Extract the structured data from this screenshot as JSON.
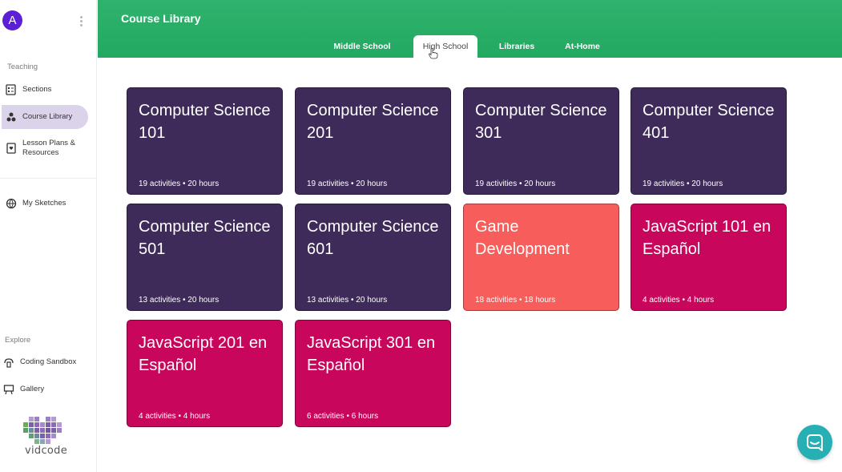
{
  "user": {
    "avatar_initial": "A"
  },
  "sidebar": {
    "teaching_label": "Teaching",
    "explore_label": "Explore",
    "items": {
      "sections": "Sections",
      "course_library": "Course Library",
      "lesson_plans_line1": "Lesson Plans &",
      "lesson_plans_line2": "Resources",
      "my_sketches": "My Sketches",
      "coding_sandbox": "Coding Sandbox",
      "gallery": "Gallery"
    },
    "logo_text": "vidcode"
  },
  "header": {
    "title": "Course Library",
    "tabs": [
      "Middle School",
      "High School",
      "Libraries",
      "At-Home"
    ],
    "active_tab": "High School"
  },
  "courses": [
    {
      "title": "Computer Science 101",
      "meta": "19 activities • 20 hours",
      "color": "#3e2b59"
    },
    {
      "title": "Computer Science 201",
      "meta": "19 activities • 20 hours",
      "color": "#3e2b59"
    },
    {
      "title": "Computer Science 301",
      "meta": "19 activities • 20 hours",
      "color": "#3e2b59"
    },
    {
      "title": "Computer Science 401",
      "meta": "19 activities • 20 hours",
      "color": "#3e2b59"
    },
    {
      "title": "Computer Science 501",
      "meta": "13 activities • 20 hours",
      "color": "#3e2b59"
    },
    {
      "title": "Computer Science 601",
      "meta": "13 activities • 20 hours",
      "color": "#3e2b59"
    },
    {
      "title": "Game Development",
      "meta": "18 activities • 18 hours",
      "color": "#f65d5b"
    },
    {
      "title": "JavaScript 101 en Español",
      "meta": "4 activities • 4 hours",
      "color": "#c8065b"
    },
    {
      "title": "JavaScript 201 en Español",
      "meta": "4 activities • 4 hours",
      "color": "#c8065b"
    },
    {
      "title": "JavaScript 301 en Español",
      "meta": "6 activities • 6 hours",
      "color": "#c8065b"
    }
  ],
  "colors": {
    "header_green": "#2fb26d",
    "accent_purple": "#5b1fd6",
    "chat_teal": "#26b0b4"
  }
}
